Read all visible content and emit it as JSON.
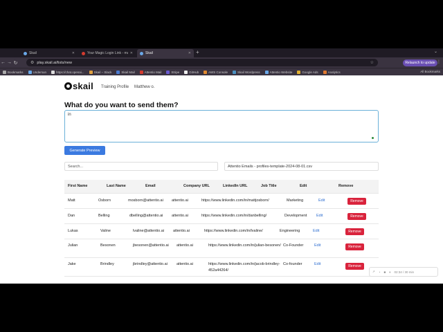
{
  "tabs": [
    {
      "title": "Skail",
      "favicon_color": "#6aa8e8",
      "active": false
    },
    {
      "title": "Your Magic Login Link - matt@",
      "favicon_color": "#d33b2f",
      "active": false
    },
    {
      "title": "Skail",
      "favicon_color": "#6aa8e8",
      "active": true
    }
  ],
  "toolbar": {
    "url": "play.skail.ai/lists/new",
    "relaunch_label": "Relaunch to update"
  },
  "bookmarks": [
    {
      "label": "Bookmarks",
      "color": "#aaa"
    },
    {
      "label": "Undersun",
      "color": "#6aa8e8"
    },
    {
      "label": "https://chat.openai...",
      "color": "#ddd"
    },
    {
      "label": "Skail – Slack",
      "color": "#e0a040"
    },
    {
      "label": "Skail Mail",
      "color": "#4a7ad0"
    },
    {
      "label": "Attentio Mail",
      "color": "#d33b2f"
    },
    {
      "label": "Stripe",
      "color": "#6a5ad0"
    },
    {
      "label": "GitHub",
      "color": "#eee"
    },
    {
      "label": "AWS Console",
      "color": "#e08a30"
    },
    {
      "label": "Skail Wordpress",
      "color": "#4a90c0"
    },
    {
      "label": "Attentio Website",
      "color": "#6aa8e8"
    },
    {
      "label": "Google Ads",
      "color": "#e0b030"
    },
    {
      "label": "Analytics",
      "color": "#e07a30"
    }
  ],
  "bookmarks_all": "All Bookmarks",
  "brand": {
    "name": "skail"
  },
  "header_nav": {
    "training_profile": "Training Profile",
    "user": "Matthew o."
  },
  "heading": "What do you want to send them?",
  "message": {
    "value": "in"
  },
  "generate_label": "Generate Preview",
  "search": {
    "placeholder": "Search..."
  },
  "file_select": "Attentio Emails - profiles-template-2024-08-01.csv",
  "table": {
    "headers": [
      "First Name",
      "Last Name",
      "Email",
      "Company URL",
      "LinkedIn URL",
      "Job Title",
      "Edit",
      "Remove"
    ],
    "edit_label": "Edit",
    "remove_label": "Remove",
    "rows": [
      {
        "first": "Matt",
        "last": "Osborn",
        "email": "mosborn@attentio.ai",
        "company": "attentio.ai",
        "linkedin": "https://www.linkedin.com/in/mattjosborn/",
        "title": "Marketing"
      },
      {
        "first": "Dan",
        "last": "Belling",
        "email": "dbelling@attentio.ai",
        "company": "attentio.ai",
        "linkedin": "https://www.linkedin.com/in/danbelling/",
        "title": "Development"
      },
      {
        "first": "Lukas",
        "last": "Valine",
        "email": "lvaline@attentio.ai",
        "company": "attentio.ai",
        "linkedin": "https://www.linkedin.com/in/lvaline/",
        "title": "Engineering"
      },
      {
        "first": "Julian",
        "last": "Besonen",
        "email": "jbesonen@attentio.ai",
        "company": "attentio.ai",
        "linkedin": "https://www.linkedin.com/in/julian-besonen/",
        "title": "Co-Founder"
      },
      {
        "first": "Jake",
        "last": "Brindley",
        "email": "jbrindley@attentio.ai",
        "company": "attentio.ai",
        "linkedin": "https://www.linkedin.com/in/jacob-brindley-452a44264/",
        "title": "Co-founder"
      }
    ]
  },
  "recorder": {
    "time": "02:34 / 30 min"
  }
}
